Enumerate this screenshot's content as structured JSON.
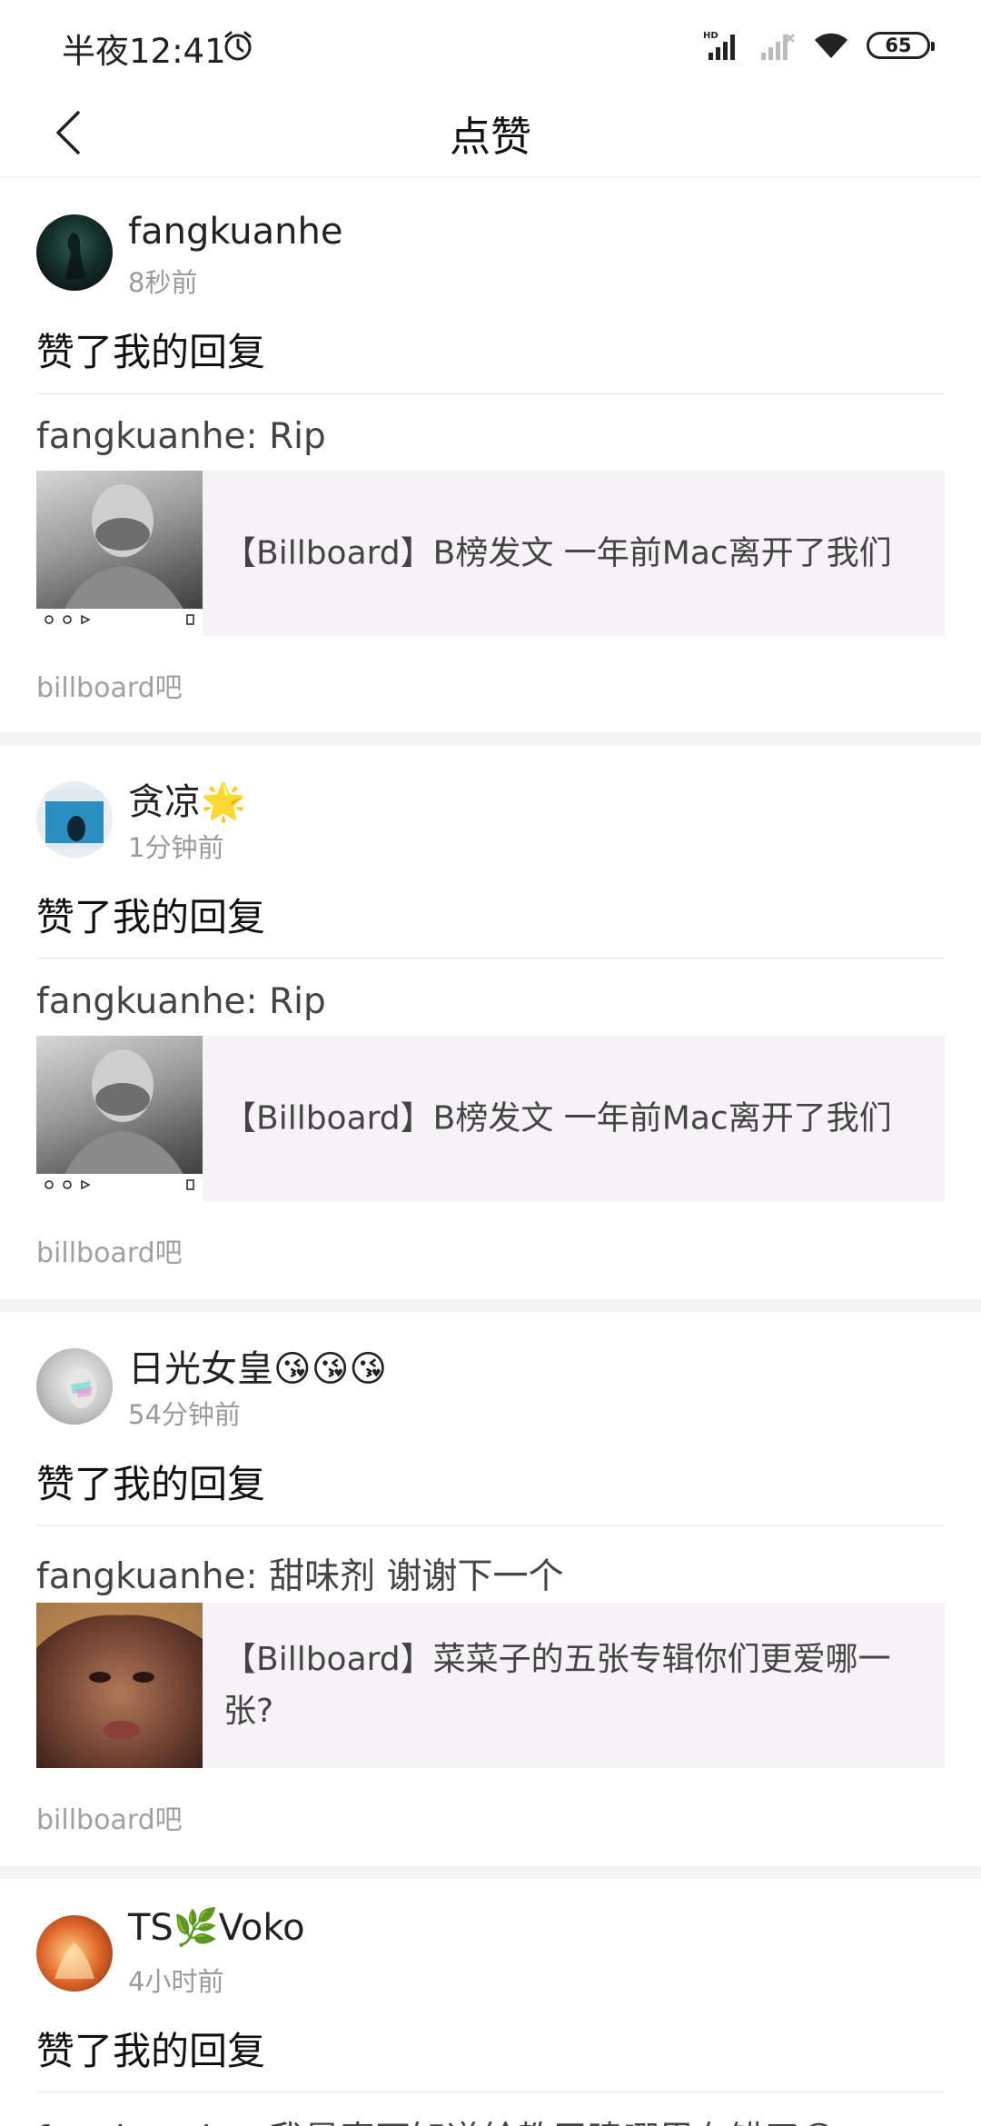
{
  "status_bar": {
    "time": "半夜12:41",
    "battery": "65"
  },
  "nav": {
    "title": "点赞"
  },
  "notifications": [
    {
      "username": "fangkuanhe",
      "time": "8秒前",
      "action": "赞了我的回复",
      "reply": "fangkuanhe: Rip",
      "post_title": "【Billboard】B榜发文 一年前Mac离开了我们",
      "forum": "billboard吧"
    },
    {
      "username": "贪凉🌟",
      "time": "1分钟前",
      "action": "赞了我的回复",
      "reply": "fangkuanhe: Rip",
      "post_title": "【Billboard】B榜发文 一年前Mac离开了我们",
      "forum": "billboard吧"
    },
    {
      "username": "日光女皇😘😘😘",
      "time": "54分钟前",
      "action": "赞了我的回复",
      "reply": "fangkuanhe: 甜味剂 谢谢下一个",
      "post_title": "【Billboard】菜菜子的五张专辑你们更爱哪一张?",
      "forum": "billboard吧"
    },
    {
      "username": "TS🌿Voko",
      "time": "4小时前",
      "action": "赞了我的回复",
      "reply": "fangkuanhe: 我是真不知道給教甲建哪里有错了😅"
    }
  ],
  "colors": {
    "background": "#ffffff",
    "band": "#f5f3f6",
    "post_bg": "#f6f3f6",
    "muted_text": "#9a9a9a"
  }
}
